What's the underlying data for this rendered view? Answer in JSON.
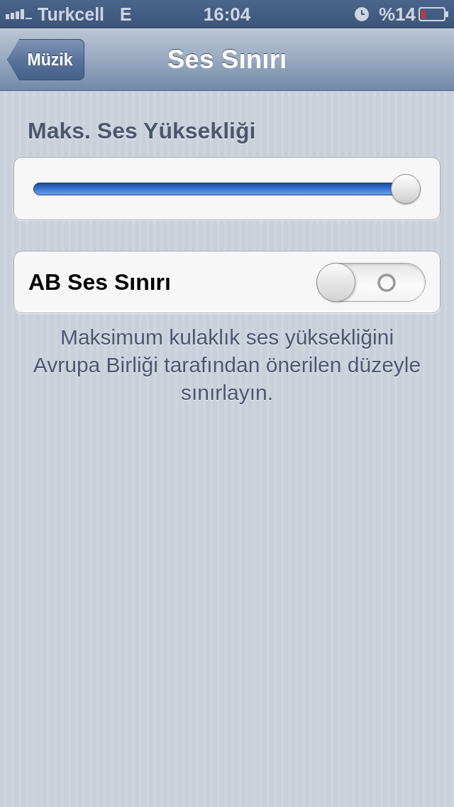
{
  "status_bar": {
    "carrier": "Turkcell",
    "network": "E",
    "time": "16:04",
    "battery": "%14"
  },
  "nav_bar": {
    "back_button": "Müzik",
    "title": "Ses Sınırı"
  },
  "sections": [
    {
      "kind": "slider",
      "header": "Maks. Ses Yüksekliği",
      "level": 1.0
    },
    {
      "kind": "toggle",
      "label": "AB Ses Sınırı",
      "on": false,
      "footer": "Maksimum kulaklık ses yüksekliğini\nAvrupa Birliği tarafından önerilen düzeyle\nsınırlayın."
    }
  ]
}
